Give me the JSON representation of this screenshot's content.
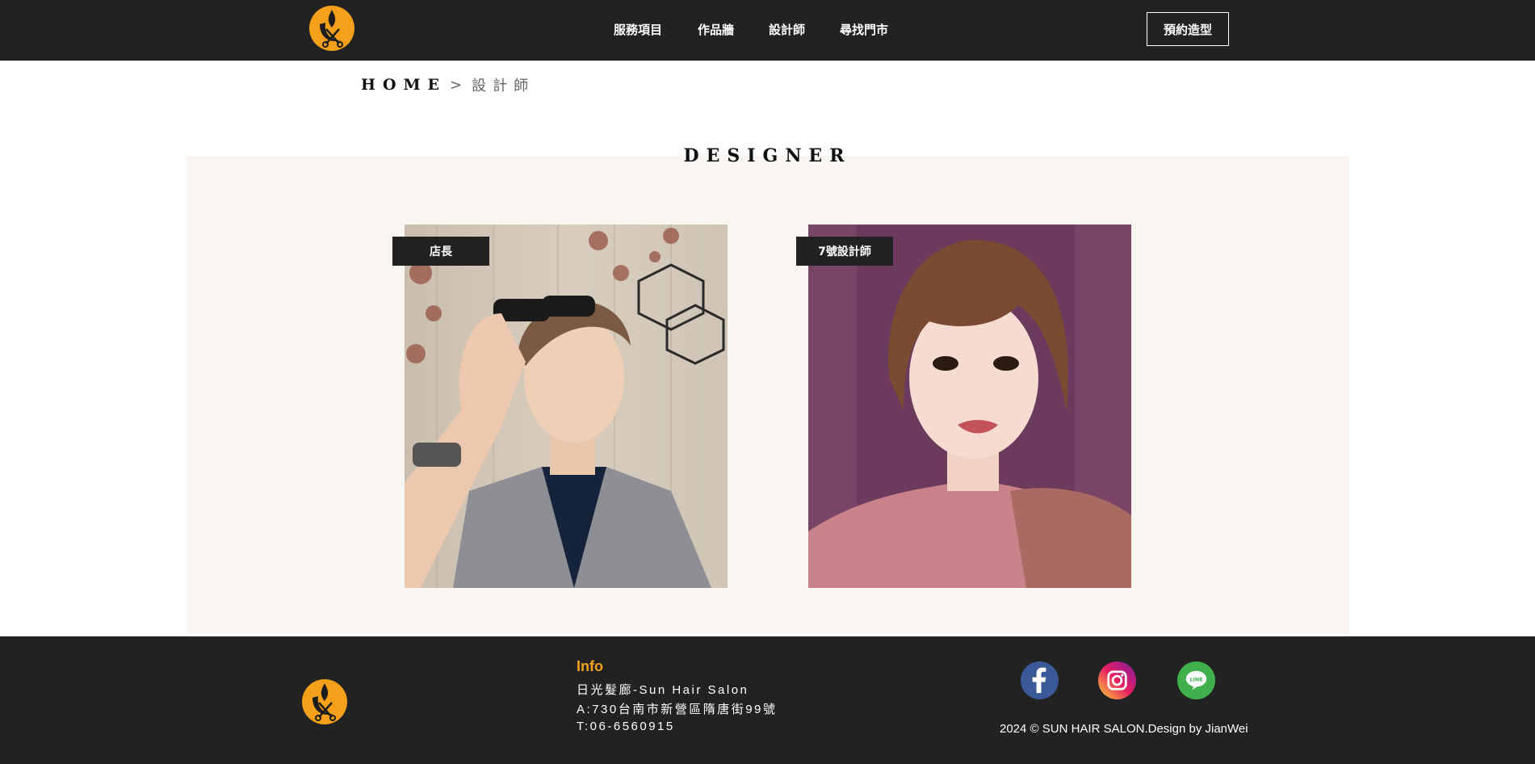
{
  "header": {
    "logo_name": "sun-hair-logo",
    "nav": [
      {
        "label": "服務項目"
      },
      {
        "label": "作品牆"
      },
      {
        "label": "設計師"
      },
      {
        "label": "尋找門市"
      }
    ],
    "book_label": "預約造型"
  },
  "breadcrumb": {
    "home": "HOME",
    "separator": ">",
    "current": "設計師"
  },
  "main": {
    "title": "DESIGNER",
    "designers": [
      {
        "tag": "店長"
      },
      {
        "tag": "7號設計師"
      }
    ]
  },
  "footer": {
    "info_title": "Info",
    "lines": [
      "日光髮廊-Sun Hair Salon",
      "A:730台南市新營區隋唐街99號",
      "T:06-6560915"
    ],
    "social": [
      "facebook-icon",
      "instagram-icon",
      "line-icon"
    ],
    "copyright": "2024 © SUN HAIR SALON.Design by JianWei"
  },
  "colors": {
    "header_bg": "#222222",
    "section_bg": "#f9f6f2",
    "accent": "#f5a01a"
  }
}
